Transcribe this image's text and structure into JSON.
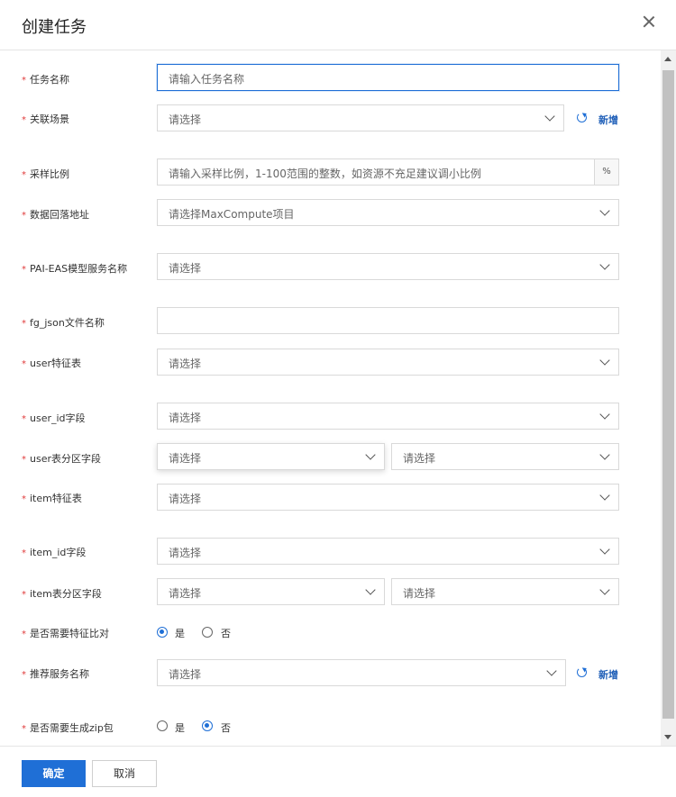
{
  "modal": {
    "title": "创建任务"
  },
  "form": {
    "task_name": {
      "label": "任务名称",
      "placeholder": "请输入任务名称"
    },
    "scene": {
      "label": "关联场景",
      "placeholder": "请选择",
      "add_link": "新增"
    },
    "sample_ratio": {
      "label": "采样比例",
      "placeholder": "请输入采样比例，1-100范围的整数，如资源不充足建议调小比例",
      "suffix": "%"
    },
    "return_address": {
      "label": "数据回落地址",
      "placeholder": "请选择MaxCompute项目"
    },
    "pai_eas": {
      "label": "PAI-EAS模型服务名称",
      "placeholder": "请选择"
    },
    "fg_json": {
      "label": "fg_json文件名称",
      "value": ""
    },
    "user_table": {
      "label": "user特征表",
      "placeholder": "请选择"
    },
    "user_id": {
      "label": "user_id字段",
      "placeholder": "请选择"
    },
    "user_partition": {
      "label": "user表分区字段",
      "placeholder_a": "请选择",
      "placeholder_b": "请选择"
    },
    "item_table": {
      "label": "item特征表",
      "placeholder": "请选择"
    },
    "item_id": {
      "label": "item_id字段",
      "placeholder": "请选择"
    },
    "item_partition": {
      "label": "item表分区字段",
      "placeholder_a": "请选择",
      "placeholder_b": "请选择"
    },
    "feature_compare": {
      "label": "是否需要特征比对",
      "yes": "是",
      "no": "否",
      "selected": "是"
    },
    "rec_service": {
      "label": "推荐服务名称",
      "placeholder": "请选择",
      "add_link": "新增"
    },
    "gen_zip": {
      "label": "是否需要生成zip包",
      "yes": "是",
      "no": "否",
      "selected": "否"
    }
  },
  "footer": {
    "confirm": "确定",
    "cancel": "取消"
  },
  "colors": {
    "primary": "#1f6fd6",
    "required": "#e03a3a",
    "link": "#1f5fb8"
  },
  "icons": {
    "close": "close-icon",
    "refresh": "refresh-icon",
    "dropdown": "chevron-down-icon"
  }
}
